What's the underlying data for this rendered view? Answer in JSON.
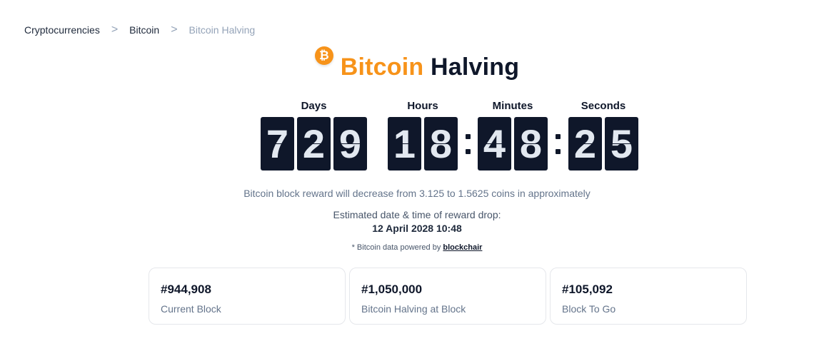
{
  "breadcrumb": {
    "items": [
      "Cryptocurrencies",
      "Bitcoin",
      "Bitcoin Halving"
    ],
    "separator": ">"
  },
  "title": {
    "logo_glyph": "₿",
    "word1": "Bitcoin",
    "word2": "Halving"
  },
  "countdown": {
    "days_label": "Days",
    "hours_label": "Hours",
    "minutes_label": "Minutes",
    "seconds_label": "Seconds",
    "days": [
      "7",
      "2",
      "9"
    ],
    "hours": [
      "1",
      "8"
    ],
    "minutes": [
      "4",
      "8"
    ],
    "seconds": [
      "2",
      "5"
    ]
  },
  "info": {
    "reward_text": "Bitcoin block reward will decrease from 3.125 to 1.5625 coins in approximately",
    "estimate_label": "Estimated date & time of reward drop:",
    "estimate_date": "12 April 2028 10:48",
    "source_prefix": "* Bitcoin data powered by",
    "source_link": "blockchair"
  },
  "cards": [
    {
      "value": "#944,908",
      "label": "Current Block"
    },
    {
      "value": "#1,050,000",
      "label": "Bitcoin Halving at Block"
    },
    {
      "value": "#105,092",
      "label": "Block To Go"
    }
  ],
  "colors": {
    "accent": "#f7931a",
    "digit_bg": "#0f172a",
    "digit_fg": "#e2e8f0"
  }
}
